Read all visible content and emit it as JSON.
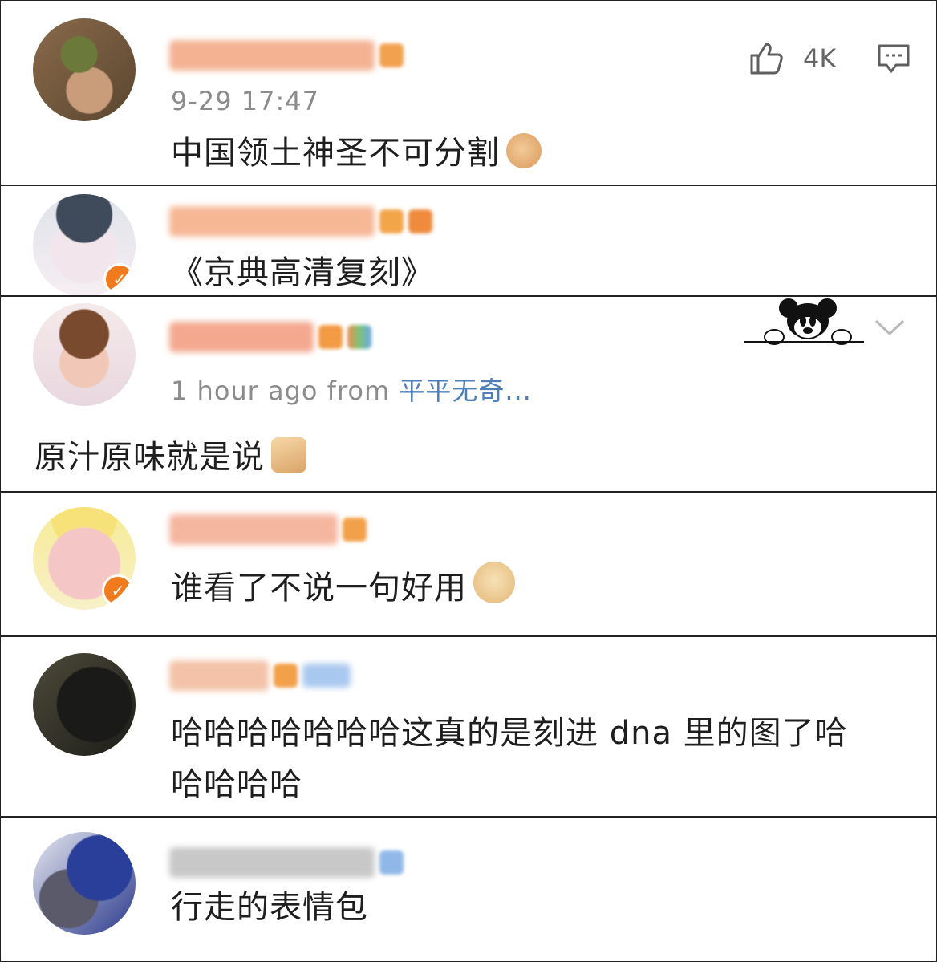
{
  "comments": [
    {
      "time": "9-29 17:47",
      "text": "中国领土神圣不可分割",
      "like_count": "4K"
    },
    {
      "text": "《京典高清复刻》"
    },
    {
      "time_prefix": "1 hour ago  from ",
      "source": "平平无奇...",
      "text": "原汁原味就是说"
    },
    {
      "text": "谁看了不说一句好用"
    },
    {
      "text_line1": "哈哈哈哈哈哈哈这真的是刻进 dna 里的图了哈",
      "text_line2": "哈哈哈哈"
    },
    {
      "text": "行走的表情包"
    }
  ],
  "icons": {
    "like": "thumbs-up-icon",
    "reply": "comment-bubble-icon",
    "expand": "chevron-down-icon",
    "sticker": "mickey-peeking-sticker"
  },
  "colors": {
    "text": "#1e1e1e",
    "meta": "#8b8b8b",
    "link": "#4e7fb8",
    "vip_orange": "#f07a1c",
    "blurred_name": "#f3b89a"
  }
}
